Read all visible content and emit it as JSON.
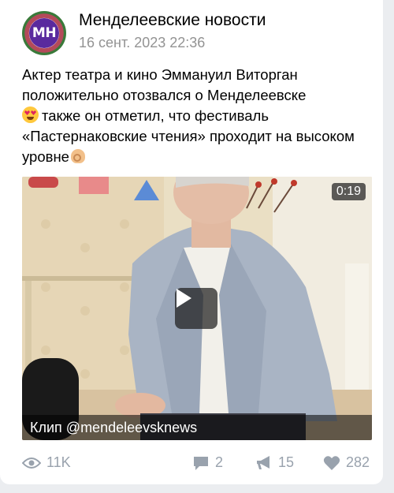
{
  "channel": {
    "name": "Менделеевские новости",
    "date": "16 сент. 2023 22:36",
    "avatar_text": "МН"
  },
  "post": {
    "paragraph1": "Актер театра и кино Эммануил Виторган положительно отозвался о Менделеевске",
    "paragraph2": "также он отметил, что фестиваль «Пастернаковские чтения» проходит на высоком уровне",
    "emoji_start": "smiling-face-with-heart-eyes",
    "emoji_end": "ok-hand"
  },
  "video": {
    "duration": "0:19",
    "caption": "Клип @mendeleevsknews"
  },
  "stats": {
    "views": "11K",
    "comments": "2",
    "reposts": "15",
    "likes": "282"
  },
  "colors": {
    "card": "#ffffff",
    "background": "#ebedf0",
    "meta_text": "#939393",
    "footer_icon": "#99a2ad"
  }
}
